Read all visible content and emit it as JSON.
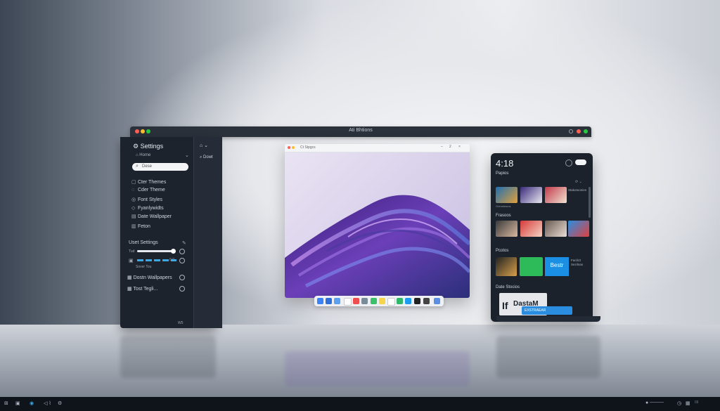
{
  "topbar": {
    "title": "Ati Bhtions"
  },
  "settings": {
    "title": "Settings",
    "home": "Home",
    "search_placeholder": "Dese",
    "subpanel_item": "Dowt",
    "menu": [
      "Cter Themes",
      "Cder Theme",
      "Font Styles",
      "Fyanlywidts",
      "Date Wallpaper",
      "Feton"
    ],
    "section_title": "Uset Settings",
    "slider_label": "Tud",
    "bar_value": "0.0",
    "bar_caption": "Sover Tou",
    "rows": [
      "Dostn Wallpapers",
      "Tost Tegli..."
    ],
    "footer": "W5"
  },
  "center_window": {
    "title": "Ct Stpgcs"
  },
  "right_panel": {
    "time": "4:18",
    "sections": [
      "Papios",
      "Frasoos",
      "Pcotos",
      "Date Stocios"
    ],
    "tile_label": "Bestr",
    "tile_caption": "Facilizt Sezilnas",
    "card_label": "DastaM",
    "button_label": "EXSTRAEAR",
    "media_captions": [
      "Stakotoonies",
      "Grimetesms"
    ]
  },
  "colors": {
    "accent": "#2a8de0",
    "panel": "#1d232d",
    "traffic_red": "#ff5f57",
    "traffic_yellow": "#febc2e",
    "traffic_green": "#28c840"
  }
}
